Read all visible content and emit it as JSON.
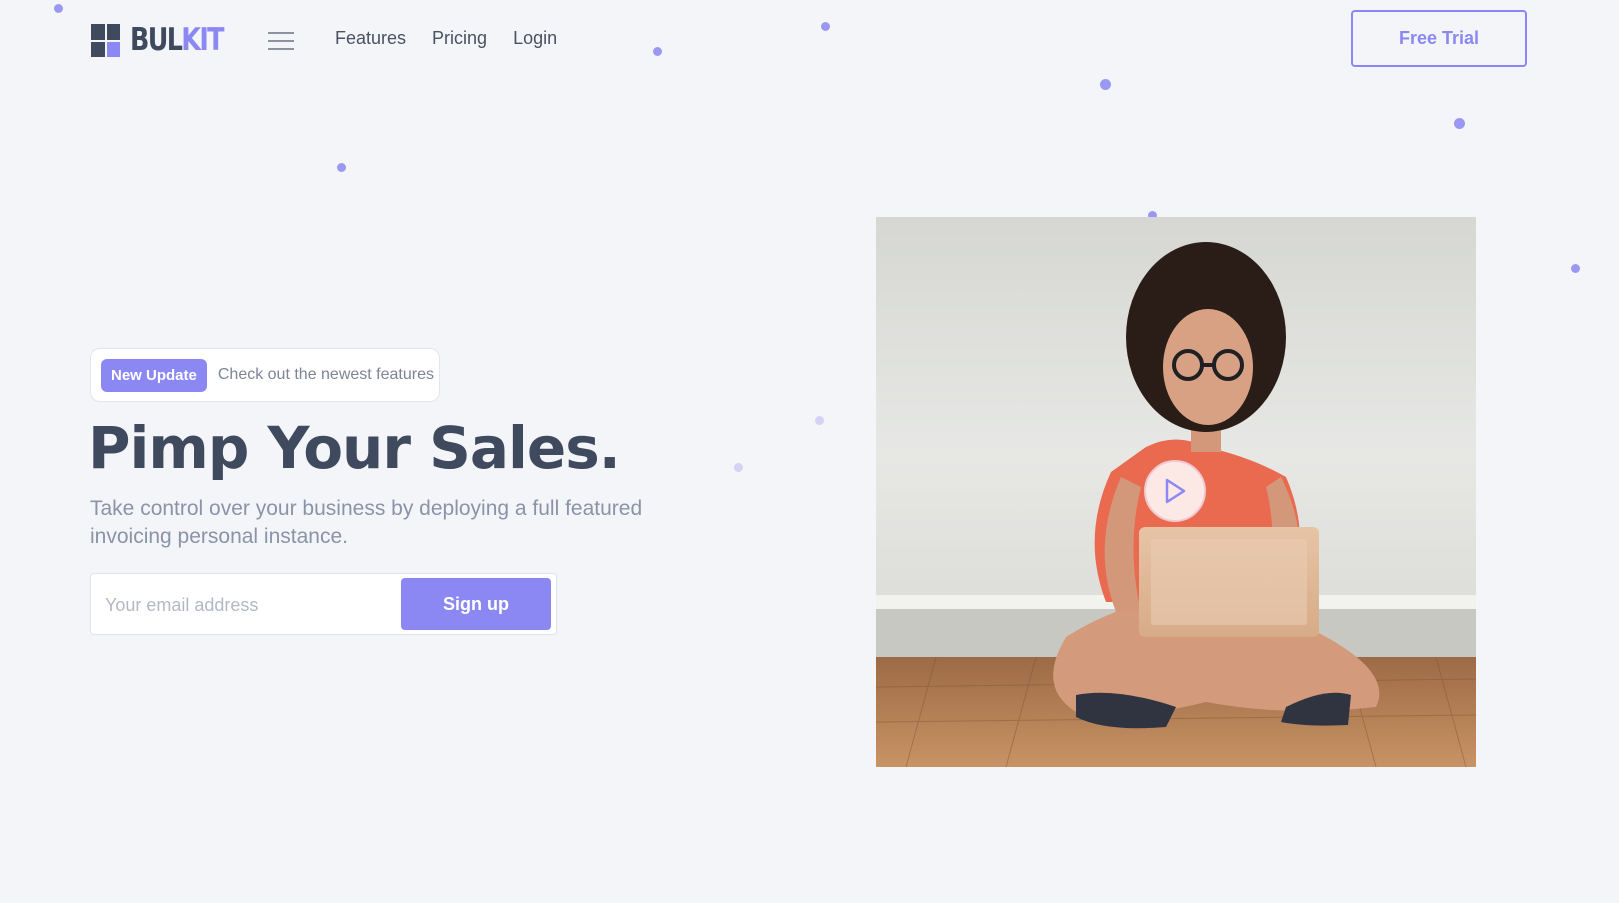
{
  "brand": {
    "name_dark": "BUL",
    "name_light": "KIT",
    "accent": "#8b88f3",
    "dark": "#3f4a5e"
  },
  "nav": {
    "links": [
      "Features",
      "Pricing",
      "Login"
    ],
    "cta": "Free Trial"
  },
  "hero": {
    "badge": "New Update",
    "badge_text": "Check out the newest features",
    "title": "Pimp Your Sales.",
    "subtitle": "Take control over your business by deploying a full featured invoicing personal instance.",
    "email_placeholder": "Your email address",
    "signup_label": "Sign up"
  },
  "icons": [
    "menu-icon",
    "play-icon",
    "logo-grid-icon"
  ]
}
